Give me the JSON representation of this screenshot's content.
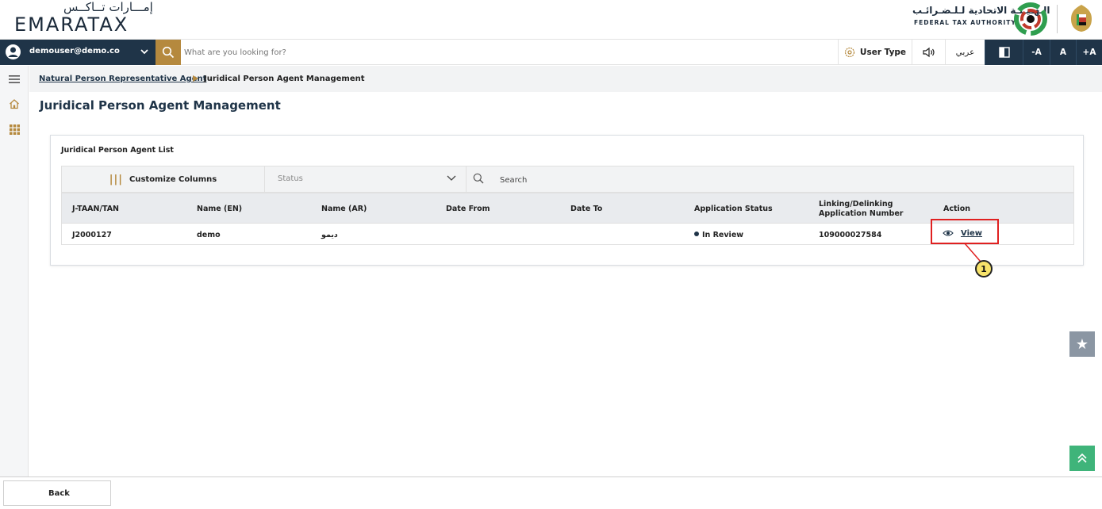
{
  "header": {
    "logo_ar": "إمـــارات تــاكــس",
    "logo_en": "EMARATAX",
    "fta_ar": "الـهـيـئـة الاتحادية لـلـضـرائـب",
    "fta_en": "FEDERAL TAX AUTHORITY"
  },
  "topbar": {
    "user_email": "demouser@demo.co",
    "search_placeholder": "What are you looking for?",
    "user_type_label": "User Type",
    "arabic_label": "عربي",
    "font_decrease": "-A",
    "font_normal": "A",
    "font_increase": "+A"
  },
  "breadcrumb": {
    "parent": "Natural Person Representative Agent",
    "current": "Juridical Person Agent Management"
  },
  "page": {
    "title": "Juridical Person Agent Management"
  },
  "card": {
    "title": "Juridical Person Agent List",
    "customize_columns": "Customize Columns",
    "status_placeholder": "Status",
    "search_placeholder": "Search"
  },
  "table": {
    "headers": {
      "jtaan": "J-TAAN/TAN",
      "name_en": "Name (EN)",
      "name_ar": "Name (AR)",
      "date_from": "Date From",
      "date_to": "Date To",
      "app_status": "Application Status",
      "linking_line1": "Linking/Delinking",
      "linking_line2": "Application Number",
      "action": "Action"
    },
    "rows": [
      {
        "jtaan": "J2000127",
        "name_en": "demo",
        "name_ar": "ديمو",
        "date_from": "",
        "date_to": "",
        "app_status": "In Review",
        "app_number": "109000027584",
        "action": "View"
      }
    ]
  },
  "annotation": {
    "callout_number": "1",
    "callout_color": "#e02020"
  },
  "footer": {
    "back_label": "Back"
  },
  "colors": {
    "navy": "#1f3448",
    "gold": "#b5893e",
    "green": "#3fb47a"
  }
}
